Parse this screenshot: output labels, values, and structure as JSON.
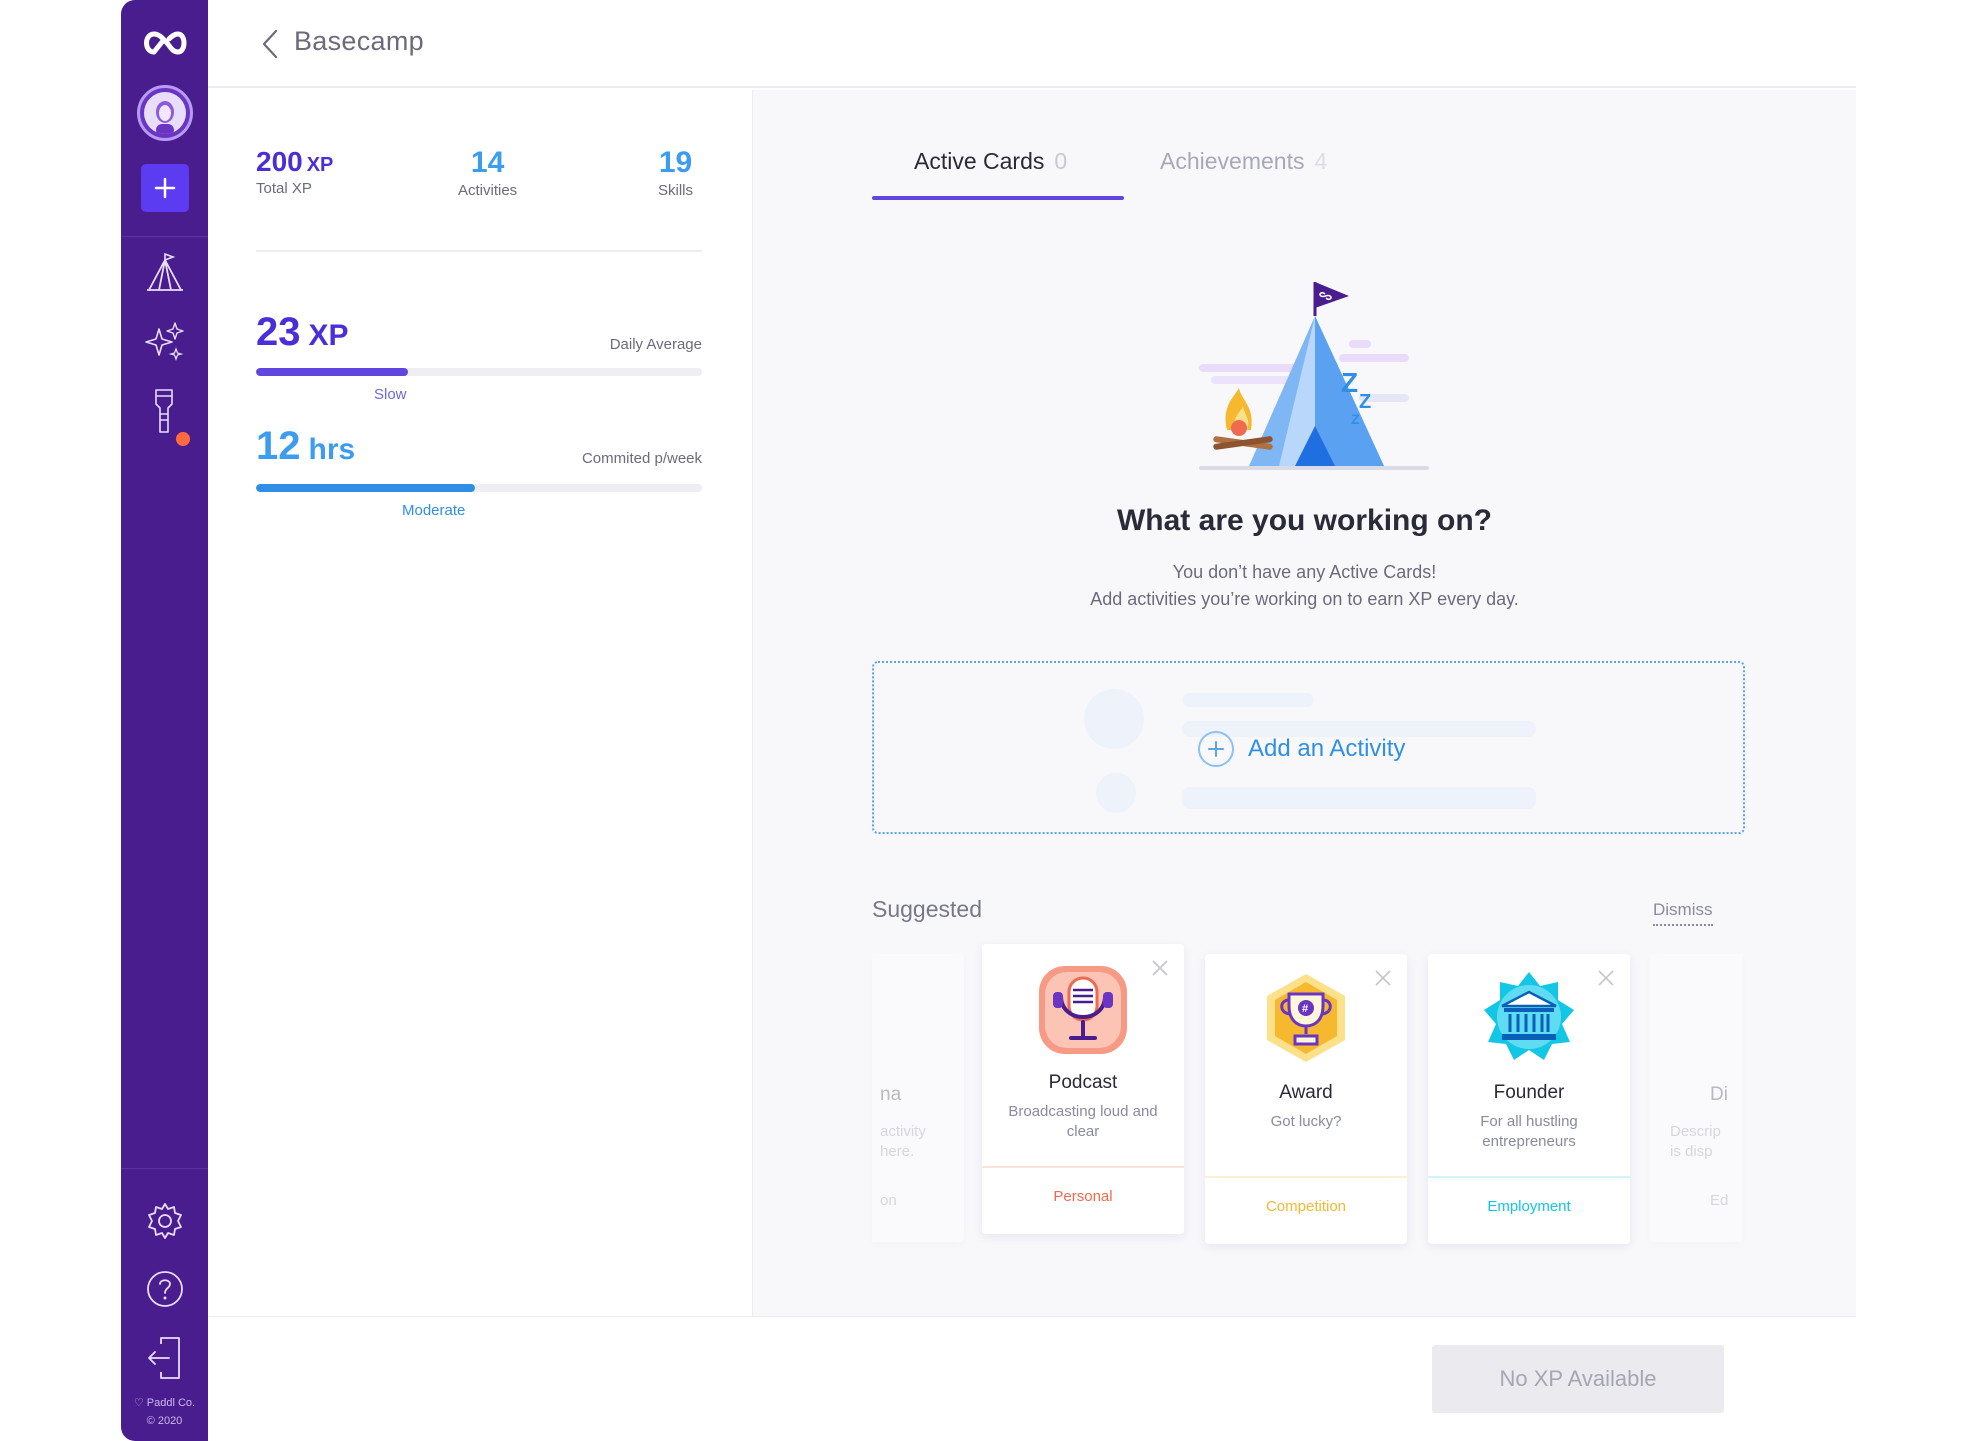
{
  "app": {
    "name": "Paddl"
  },
  "header": {
    "title": "Basecamp"
  },
  "stats": {
    "total_xp": {
      "value": "200",
      "unit": "XP",
      "label": "Total XP"
    },
    "activities": {
      "value": "14",
      "label": "Activities"
    },
    "skills": {
      "value": "19",
      "label": "Skills"
    },
    "daily": {
      "value": "23",
      "unit": "XP",
      "label": "Daily Average",
      "note": "Slow",
      "progress": 0.34
    },
    "weekly": {
      "value": "12",
      "unit": "hrs",
      "label": "Commited p/week",
      "note": "Moderate",
      "progress": 0.49
    }
  },
  "tabs": [
    {
      "label": "Active Cards",
      "count": "0"
    },
    {
      "label": "Achievements",
      "count": "4"
    }
  ],
  "empty_state": {
    "title": "What are you working on?",
    "line1": "You don’t have any Active Cards!",
    "line2": "Add activities you’re working on to earn XP every day."
  },
  "add_activity": {
    "label": "Add an Activity"
  },
  "suggested": {
    "title": "Suggested",
    "dismiss": "Dismiss",
    "cards": [
      {
        "title": "Podcast",
        "desc": "Broadcasting loud and clear",
        "tag": "Personal",
        "color": "#f06a4f",
        "icon": "microphone-icon"
      },
      {
        "title": "Award",
        "desc": "Got lucky?",
        "tag": "Competition",
        "color": "#f5b82e",
        "icon": "trophy-icon"
      },
      {
        "title": "Founder",
        "desc": "For all hustling entrepreneurs",
        "tag": "Employment",
        "color": "#12c6e6",
        "icon": "bank-icon"
      }
    ],
    "faded_left": {
      "title": "na",
      "desc": "activity here.",
      "tag": "on"
    },
    "faded_right": {
      "title": "Di",
      "desc": "Descrip is disp",
      "tag": "Ed"
    }
  },
  "footer": {
    "brand": "♡ Paddl Co.",
    "year": "© 2020"
  },
  "action": {
    "label": "No XP Available"
  },
  "colors": {
    "sidebar": "#4a1d8f",
    "accent": "#6145e0",
    "blue": "#3b9cf0"
  }
}
